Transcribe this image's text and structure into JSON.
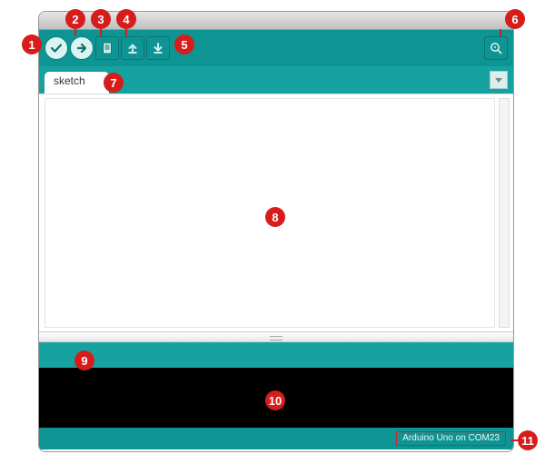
{
  "callouts": {
    "c1": "1",
    "c2": "2",
    "c3": "3",
    "c4": "4",
    "c5": "5",
    "c6": "6",
    "c7": "7",
    "c8": "8",
    "c9": "9",
    "c10": "10",
    "c11": "11"
  },
  "toolbar": {
    "verify": "verify",
    "upload": "upload",
    "new": "new",
    "open": "open",
    "save": "save",
    "serial": "serial-monitor"
  },
  "tabs": {
    "sketch_label": "sketch",
    "menu": "tab-menu"
  },
  "status": {
    "board_port": "Arduino Uno on COM23"
  }
}
